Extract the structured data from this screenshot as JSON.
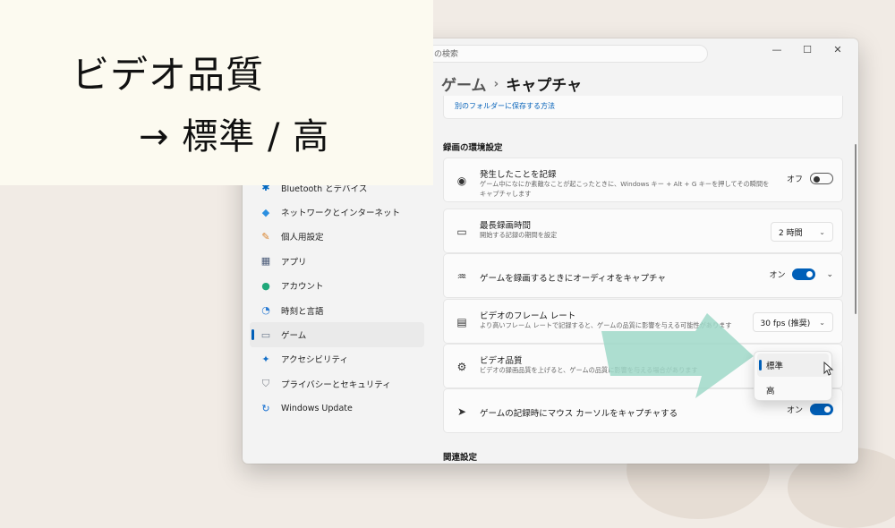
{
  "caption": {
    "line1": "ビデオ品質",
    "line2": "→ 標準 / 高"
  },
  "window": {
    "search_placeholder": "の検索",
    "controls": [
      "—",
      "☐",
      "✕"
    ]
  },
  "breadcrumb": {
    "parent": "ゲーム",
    "separator": "›",
    "current": "キャプチャ"
  },
  "top_card_link": "別のフォルダーに保存する方法",
  "sidebar": {
    "items": [
      {
        "label": "Bluetooth とデバイス",
        "icon": "bluetooth-icon",
        "glyph": "✱",
        "color": "#0067c0"
      },
      {
        "label": "ネットワークとインターネット",
        "icon": "wifi-icon",
        "glyph": "◆",
        "color": "#2b8fe0"
      },
      {
        "label": "個人用設定",
        "icon": "brush-icon",
        "glyph": "✎",
        "color": "#d9822b"
      },
      {
        "label": "アプリ",
        "icon": "apps-icon",
        "glyph": "▦",
        "color": "#4a5a78"
      },
      {
        "label": "アカウント",
        "icon": "account-icon",
        "glyph": "●",
        "color": "#1fa87a"
      },
      {
        "label": "時刻と言語",
        "icon": "globe-clock-icon",
        "glyph": "◔",
        "color": "#2a7bd3"
      },
      {
        "label": "ゲーム",
        "icon": "gamepad-icon",
        "glyph": "▭",
        "color": "#6b7a8c",
        "active": true
      },
      {
        "label": "アクセシビリティ",
        "icon": "accessibility-icon",
        "glyph": "✦",
        "color": "#1570c8"
      },
      {
        "label": "プライバシーとセキュリティ",
        "icon": "shield-icon",
        "glyph": "⛉",
        "color": "#7a7f87"
      },
      {
        "label": "Windows Update",
        "icon": "windows-update-icon",
        "glyph": "↻",
        "color": "#0f6cd0"
      }
    ]
  },
  "recording_section": {
    "title": "録画の環境設定",
    "cards": [
      {
        "title": "発生したことを記録",
        "desc": "ゲーム中になにか素敵なことが起こったときに、Windows キー + Alt + G キーを押してその瞬間をキャプチャします",
        "toggle_label": "オフ",
        "icon": "record-icon",
        "glyph": "◉"
      },
      {
        "title": "最長録画時間",
        "desc": "開始する記録の期間を設定",
        "dropdown_value": "2 時間",
        "icon": "video-camera-icon",
        "glyph": "▭"
      },
      {
        "title": "ゲームを録画するときにオーディオをキャプチャ",
        "toggle_label": "オン",
        "icon": "audio-wave-icon",
        "glyph": "♒"
      },
      {
        "title": "ビデオのフレーム レート",
        "desc": "より高いフレーム レートで記録すると、ゲームの品質に影響を与える可能性があります",
        "dropdown_value": "30 fps (推奨)",
        "icon": "fps-icon",
        "glyph": "▤"
      },
      {
        "title": "ビデオ品質",
        "desc": "ビデオの録画品質を上げると、ゲームの品質に影響を与える場合があります",
        "icon": "video-quality-icon",
        "glyph": "⚙"
      },
      {
        "title": "ゲームの記録時にマウス カーソルをキャプチャする",
        "toggle_label": "オン",
        "icon": "mouse-cursor-icon",
        "glyph": "➤"
      }
    ]
  },
  "quality_popup": {
    "options": [
      "標準",
      "高"
    ],
    "selected": "標準"
  },
  "related_section": {
    "title": "関連設定"
  },
  "colors": {
    "accent": "#005fb8",
    "arrow": "#9fd8c8"
  }
}
